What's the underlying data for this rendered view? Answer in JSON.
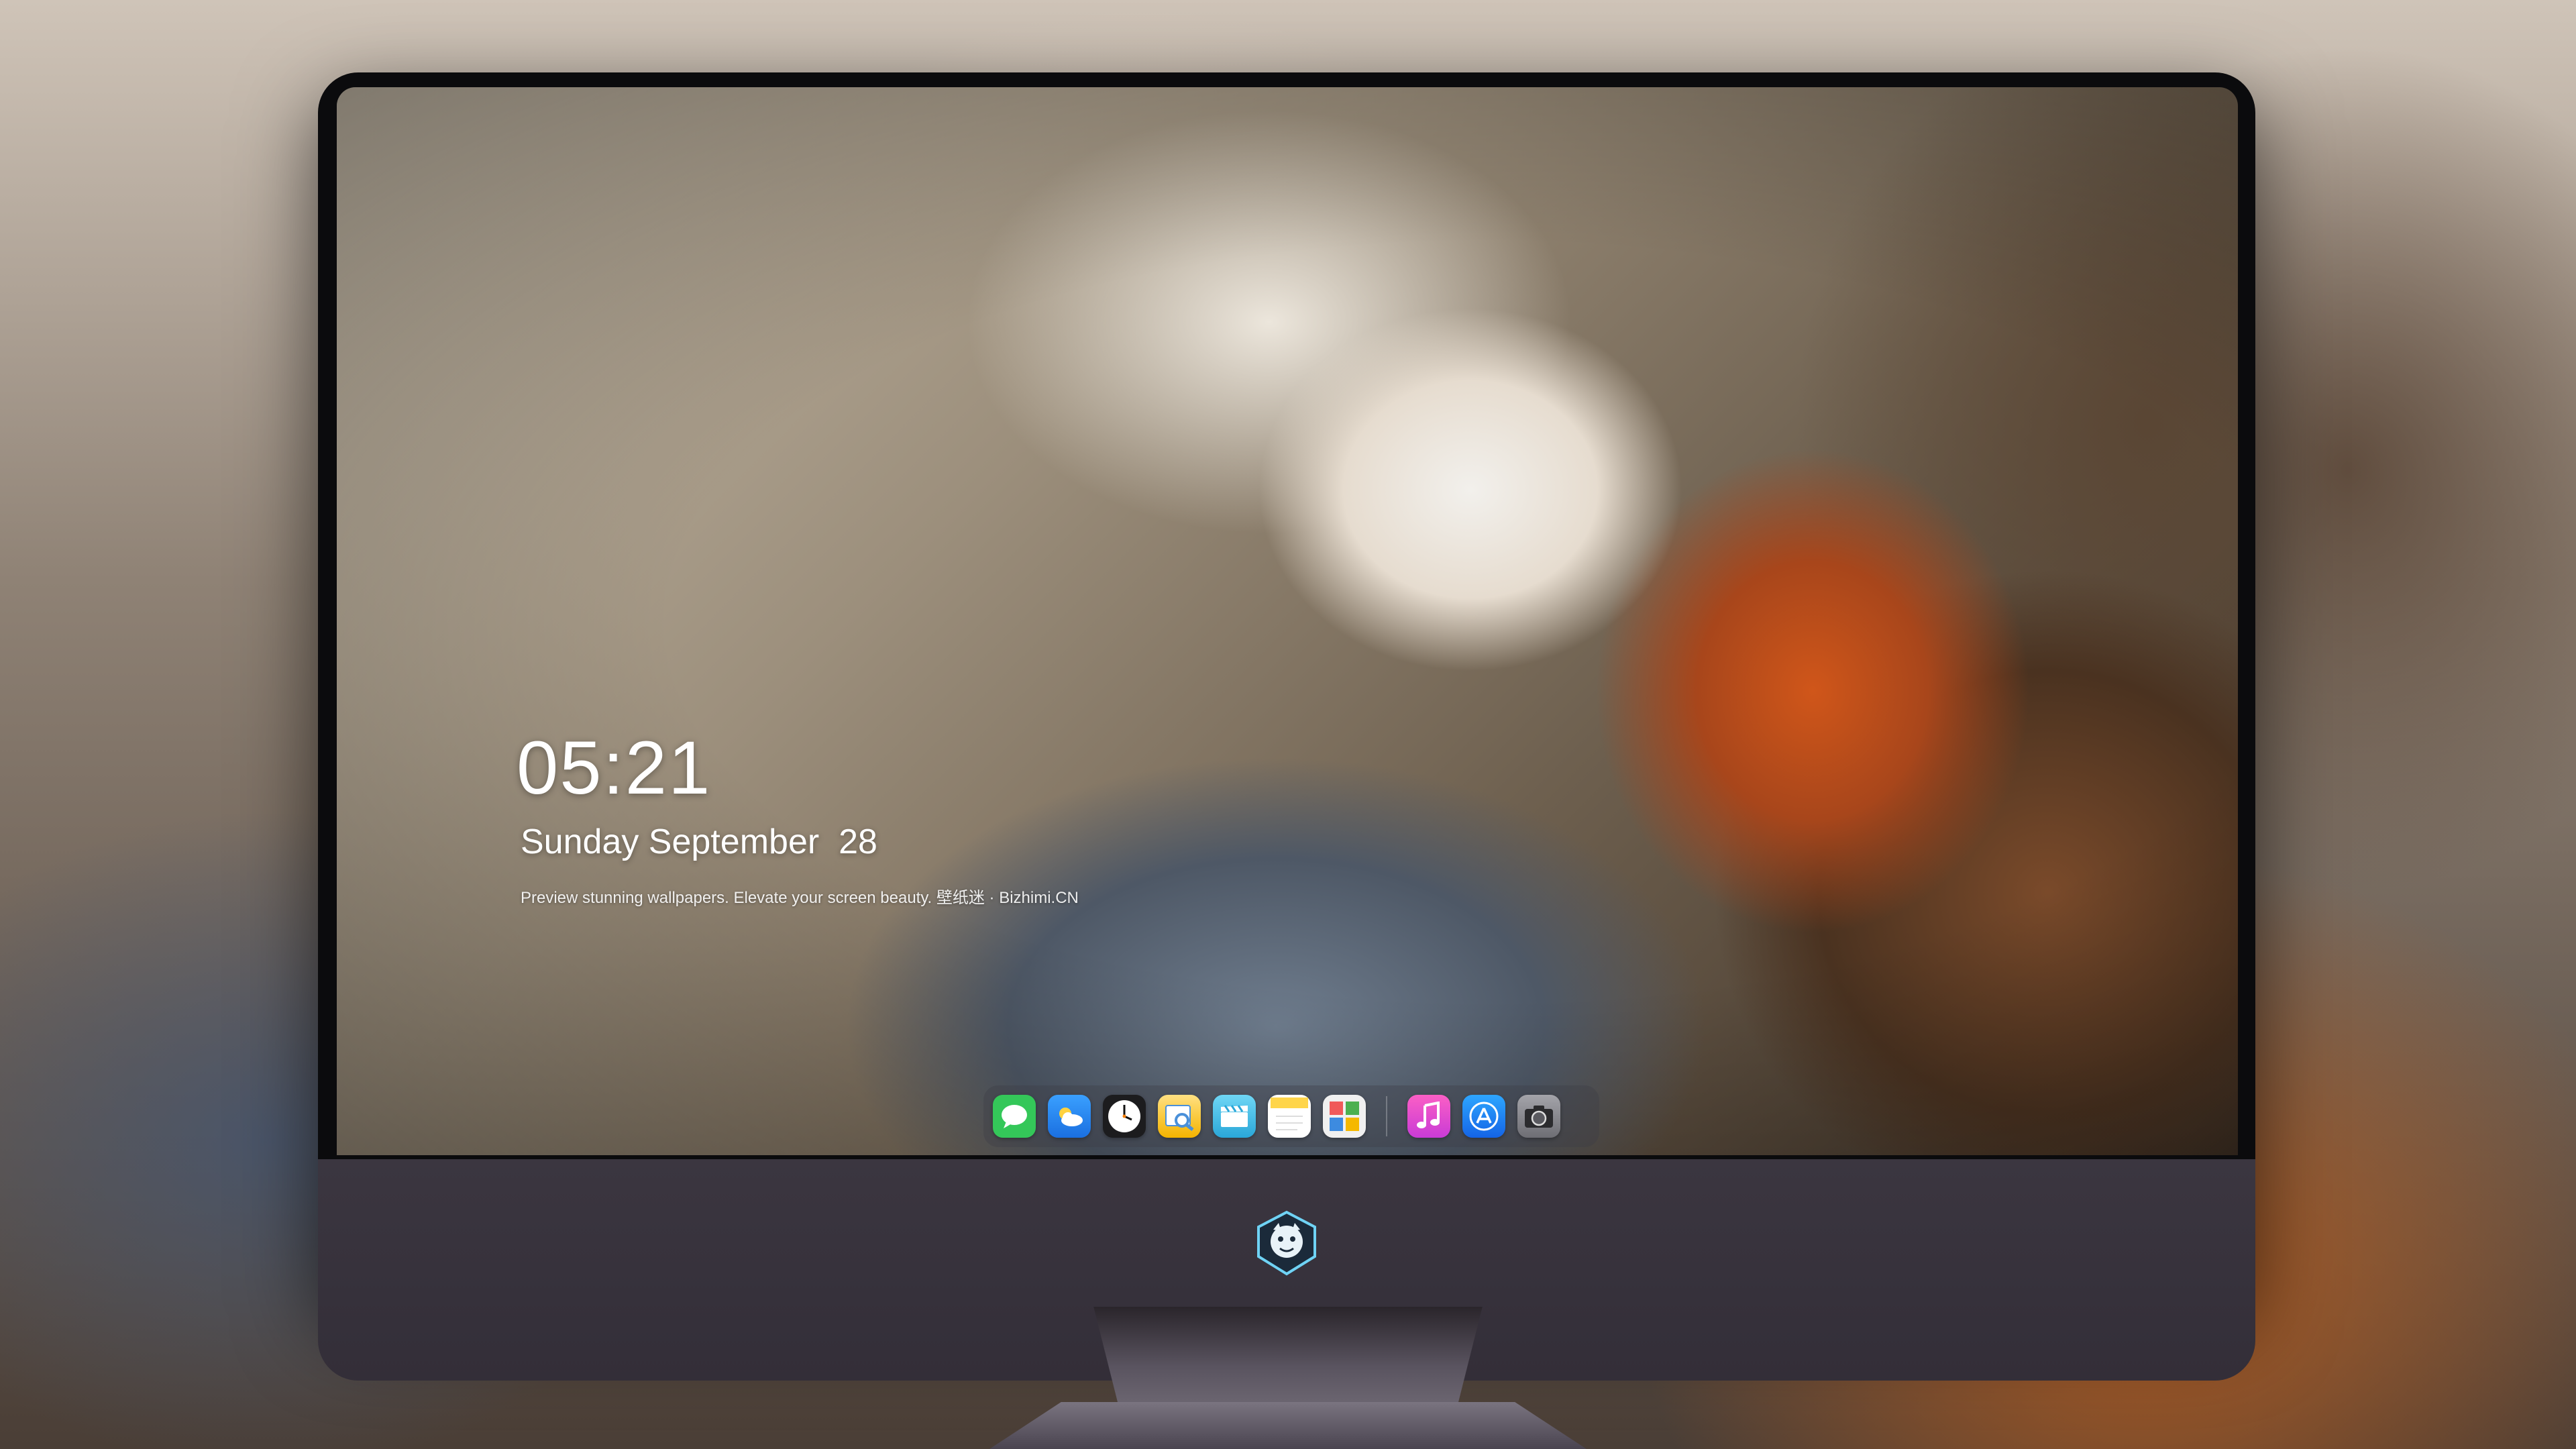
{
  "lockscreen": {
    "time": "05:21",
    "date": "Sunday September  28",
    "tagline": "Preview stunning wallpapers. Elevate your screen beauty. 壁纸迷 · Bizhimi.CN"
  },
  "dock": {
    "apps": [
      {
        "icon": "messages-icon",
        "color": "#34c759"
      },
      {
        "icon": "weather-icon",
        "color": "#2f8cf5"
      },
      {
        "icon": "clock-icon",
        "color": "#1c1c1e"
      },
      {
        "icon": "preview-icon",
        "color": "#f4c542"
      },
      {
        "icon": "clips-icon",
        "color": "#4fc3e8"
      },
      {
        "icon": "notes-icon",
        "color": "#ffd54a"
      },
      {
        "icon": "photo-booth-icon",
        "color": "#f0f0f0"
      },
      {
        "icon": "music-icon",
        "color": "#f04fa8"
      },
      {
        "icon": "app-store-icon",
        "color": "#1f8ef5"
      },
      {
        "icon": "camera-icon",
        "color": "#8e8e93"
      }
    ]
  },
  "monitor": {
    "chin_logo": "dragon-logo-icon",
    "bezel_color": "#0b0b0d",
    "chin_color": "#38333d"
  }
}
